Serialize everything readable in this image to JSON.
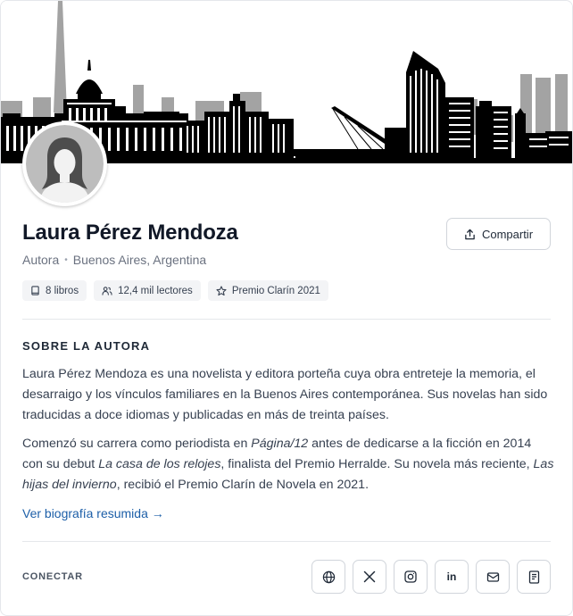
{
  "profile": {
    "name": "Laura Pérez Mendoza",
    "role": "Autora",
    "separator": "•",
    "location": "Buenos Aires, Argentina",
    "share_label": "Compartir"
  },
  "stats": {
    "books": "8 libros",
    "readers": "12,4 mil lectores",
    "award": "Premio Clarín 2021"
  },
  "about": {
    "title": "SOBRE LA AUTORA",
    "p1": "Laura Pérez Mendoza es una novelista y editora porteña cuya obra entreteje la memoria, el desarraigo y los vínculos familiares en la Buenos Aires contemporánea. Sus novelas han sido traducidas a doce idiomas y publicadas en más de treinta países.",
    "p2": {
      "a": "Comenzó su carrera como periodista en ",
      "b": "Página/12",
      "c": " antes de dedicarse a la ficción en 2014 con su debut ",
      "d": "La casa de los relojes",
      "e": ", finalista del Premio Herralde. Su novela más reciente, ",
      "f": "Las hijas del invierno",
      "g": ", recibió el Premio Clarín de Novela en 2021."
    },
    "link": "Ver biografía resumida →"
  },
  "connect": {
    "label": "CONECTAR",
    "icons": [
      "globe-icon",
      "x-icon",
      "instagram-icon",
      "linkedin-icon",
      "mail-icon",
      "book-icon"
    ],
    "linkedin_text": "in"
  },
  "colors": {
    "link": "#1d5fa8",
    "skyline": "#000000",
    "skyline_gray": "#a3a3a3"
  }
}
